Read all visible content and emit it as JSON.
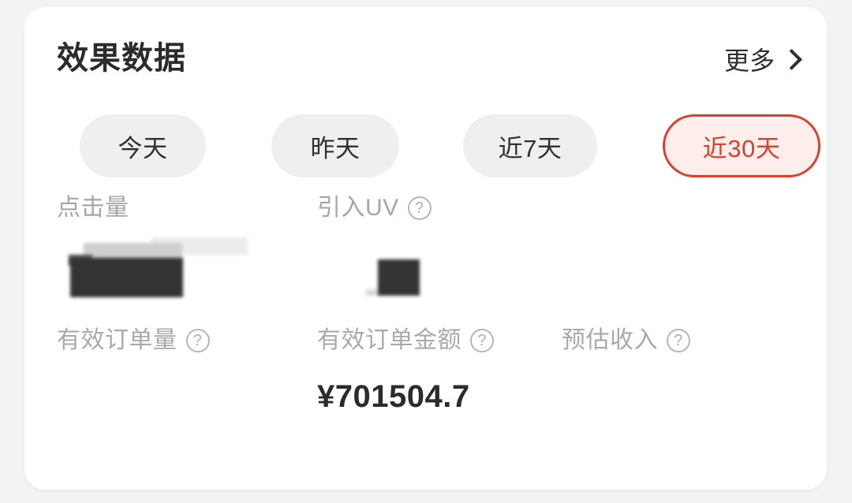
{
  "card": {
    "title": "效果数据",
    "more": {
      "label": "更多",
      "icon": "chevron-right-icon"
    }
  },
  "tabs": [
    {
      "label": "今天",
      "active": false
    },
    {
      "label": "昨天",
      "active": false
    },
    {
      "label": "近7天",
      "active": false
    },
    {
      "label": "近30天",
      "active": true
    }
  ],
  "metrics": {
    "row1": [
      {
        "label": "点击量",
        "has_help": false,
        "value": "",
        "redacted": true
      },
      {
        "label": "引入UV",
        "has_help": true,
        "help_icon": "question-circle-icon",
        "value": "",
        "redacted": true
      }
    ],
    "row2": [
      {
        "label": "有效订单量",
        "has_help": true,
        "help_icon": "question-circle-icon",
        "value": ""
      },
      {
        "label": "有效订单金额",
        "has_help": true,
        "help_icon": "question-circle-icon",
        "value": "¥701504.7"
      },
      {
        "label": "预估收入",
        "has_help": true,
        "help_icon": "question-circle-icon",
        "value": ""
      }
    ]
  },
  "icons": {
    "help": "?"
  },
  "colors": {
    "page_background": "#f2f3f5",
    "card_background": "#ffffff",
    "accent_red": "#d9402f",
    "accent_red_fill": "#fdeeec",
    "pill_gray": "#efefef",
    "label_gray": "#a6a6a6",
    "text_dark": "#2b2b2b",
    "redaction": "#333333"
  }
}
